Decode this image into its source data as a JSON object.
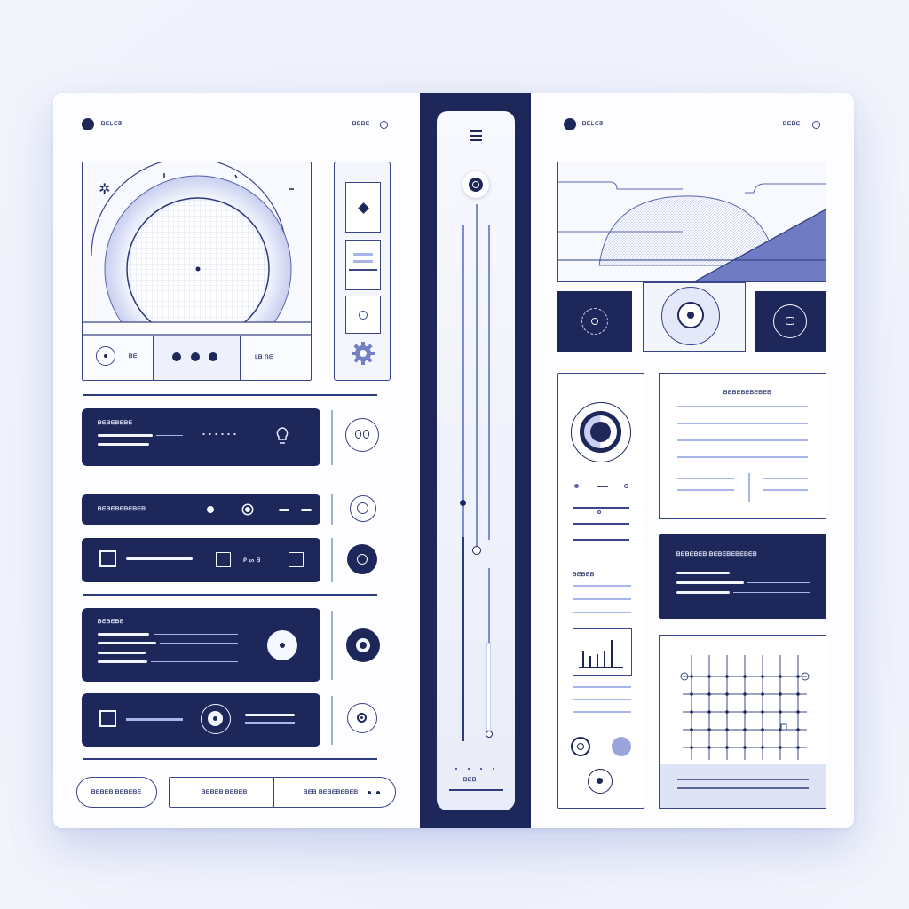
{
  "left_panel": {
    "header_label": "ᗷᗴᒪᑕᘔ",
    "header_right_label": "ᗷᗴᗷᗴ",
    "media_card": {
      "star_glyph": "✲",
      "left_cell_text": "ᗷᗴ",
      "right_cell_text": "ᒪᗷ ᑎᗴ"
    },
    "side_tool_icons": [
      "diamond-icon",
      "list-icon",
      "pin-icon",
      "gear-icon"
    ],
    "rows": [
      {
        "label": "ᗷᗴᗷᗴᗷᗴᗷᗴ",
        "kind": "large"
      },
      {
        "label": "ᗷᗴᗷᗴᗷᗴᗷᗴᗷᗴᗷ",
        "kind": "slim"
      },
      {
        "label": "",
        "kind": "checkbox"
      },
      {
        "label": "ᗷᗴᗷᗴᗷᗴ",
        "kind": "large-knob"
      },
      {
        "label": "",
        "kind": "checkbox-disc"
      }
    ],
    "footer_buttons": [
      "ᗷᗴᗷᗴᗷ ᗷᗴᗷᗴᗷᗴ",
      "ᗷᗴᗷᗴᗷ ᗷᗴᗷᗴᗷ",
      "ᗷᗴᗷ ᗷᗴᗷᗴᗷᗴᗷᗴᗷ"
    ],
    "middle_cell_text": "ᑭ ᔕ ᗷ"
  },
  "center_rail": {
    "menu_icon": "hamburger-icon",
    "bottom_label": "ᗷᗴᗷ",
    "slider_values": [
      0.62,
      0.58,
      0.75
    ]
  },
  "right_panel": {
    "header_label": "ᗷᗴᒪᑕᘔ",
    "header_right_label": "ᗷᗴᗷᗴ",
    "doc_card_title": "ᗷᗴᗷᗴᗷᗴᗷᗴᗷᗴᗷ",
    "navy_card_title": "ᗷᗴᗷᗴᗷᗴᗷ ᗷᗴᗷᗴᗷᗴᗷᗴᗷᗴᗷ",
    "sidebar_subheading": "ᗷᗴᗷᗴᗷ"
  },
  "colors": {
    "navy": "#1e2759",
    "accent_light": "#a9b4ea",
    "line": "#2f3a7a"
  }
}
